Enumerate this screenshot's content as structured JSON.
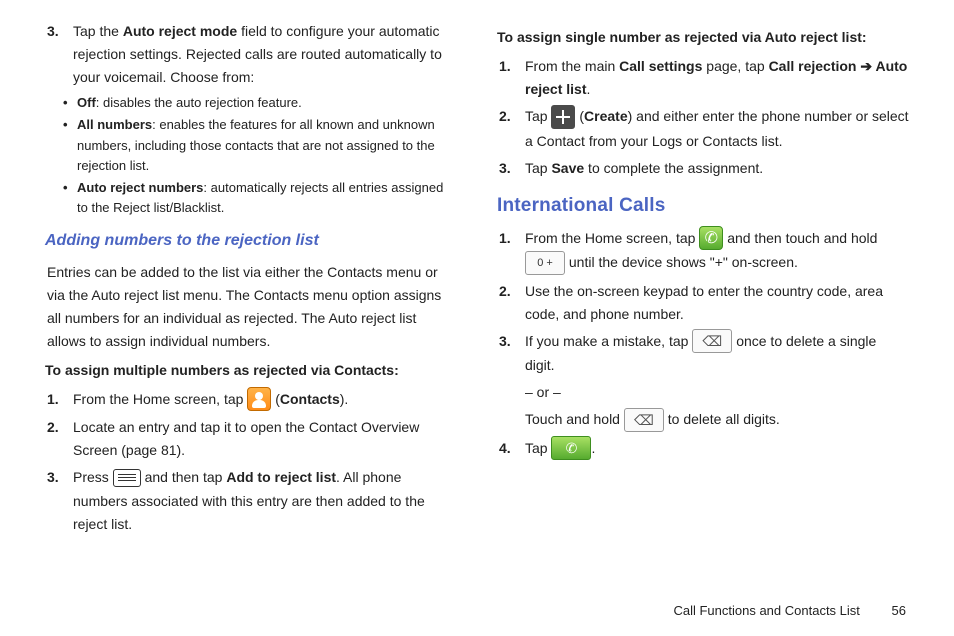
{
  "col1": {
    "step3": {
      "num": "3.",
      "t1": "Tap the ",
      "b1": "Auto reject mode",
      "t2": " field to configure your automatic rejection settings. Rejected calls are routed automatically to your voicemail. Choose from:"
    },
    "bullets": [
      {
        "b": "Off",
        "t": ": disables the auto rejection feature."
      },
      {
        "b": "All numbers",
        "t": ": enables the features for all known and unknown numbers, including those contacts that are not assigned to the rejection list."
      },
      {
        "b": "Auto reject numbers",
        "t": ": automatically rejects all entries assigned to the Reject list/Blacklist."
      }
    ],
    "h_sub": "Adding numbers to the rejection list",
    "para": "Entries can be added to the list via either the Contacts menu or via the Auto reject list menu. The Contacts menu option assigns all numbers for an individual as rejected. The Auto reject list allows to assign individual numbers.",
    "bold_line": "To assign multiple numbers as rejected via Contacts:",
    "c1": {
      "num": "1.",
      "t1": "From the Home screen, tap ",
      "t2": " (",
      "b": "Contacts",
      "t3": ")."
    },
    "c2": {
      "num": "2.",
      "t": "Locate an entry and tap it to open the Contact Overview Screen (page 81)."
    },
    "c3": {
      "num": "3.",
      "t1": "Press ",
      "t2": " and then tap ",
      "b": "Add to reject list",
      "t3": ". All phone numbers associated with this entry are then added to the reject list."
    }
  },
  "col2": {
    "bold_line": "To assign single number as rejected via Auto reject list:",
    "s1": {
      "num": "1.",
      "t1": "From the main ",
      "b1": "Call settings",
      "t2": " page, tap ",
      "b2": "Call rejection ➔ Auto reject list",
      "t3": "."
    },
    "s2": {
      "num": "2.",
      "t1": "Tap ",
      "t2": " (",
      "b": "Create",
      "t3": ") and either enter the phone number or select a Contact from your Logs or Contacts list."
    },
    "s3": {
      "num": "3.",
      "t1": "Tap ",
      "b": "Save",
      "t2": " to complete the assignment."
    },
    "h_section": "International Calls",
    "i1": {
      "num": "1.",
      "t1": "From the Home screen, tap ",
      "t2": " and then touch and hold ",
      "key": "0  +",
      "t3": " until the device shows  \"+\" on-screen."
    },
    "i2": {
      "num": "2.",
      "t": "Use the on-screen keypad to enter the country code, area code, and phone number."
    },
    "i3": {
      "num": "3.",
      "t1": "If you make a mistake, tap ",
      "t2": " once to delete a single digit.",
      "or": "– or –",
      "t3": "Touch and hold ",
      "t4": " to delete all digits."
    },
    "i4": {
      "num": "4.",
      "t1": "Tap ",
      "t2": "."
    }
  },
  "footer": {
    "label": "Call Functions and Contacts List",
    "page": "56"
  }
}
